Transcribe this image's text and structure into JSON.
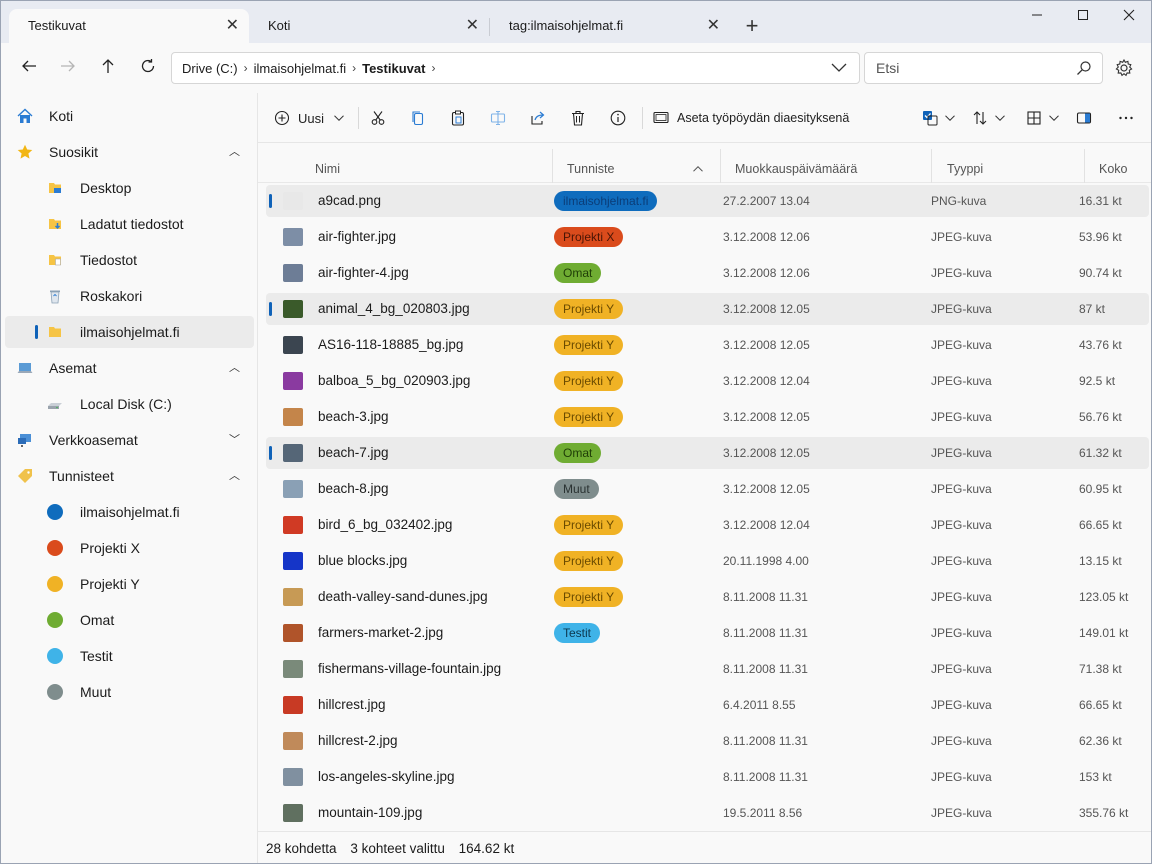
{
  "tabs": [
    {
      "label": "Testikuvat",
      "active": true
    },
    {
      "label": "Koti",
      "active": false
    },
    {
      "label": "tag:ilmaisohjelmat.fi",
      "active": false
    }
  ],
  "address": {
    "crumbs": [
      "Drive (C:)",
      "ilmaisohjelmat.fi",
      "Testikuvat"
    ],
    "search_placeholder": "Etsi"
  },
  "sidebar": {
    "items": [
      {
        "label": "Koti",
        "icon": "home-icon"
      },
      {
        "label": "Suosikit",
        "icon": "star-icon",
        "expanded": true
      },
      {
        "label": "Desktop",
        "icon": "desktop-folder-icon"
      },
      {
        "label": "Ladatut tiedostot",
        "icon": "downloads-folder-icon"
      },
      {
        "label": "Tiedostot",
        "icon": "documents-folder-icon"
      },
      {
        "label": "Roskakori",
        "icon": "recycle-bin-icon"
      },
      {
        "label": "ilmaisohjelmat.fi",
        "icon": "folder-icon",
        "selected": true
      },
      {
        "label": "Asemat",
        "icon": "drives-icon",
        "expanded": true
      },
      {
        "label": "Local Disk (C:)",
        "icon": "local-disk-icon"
      },
      {
        "label": "Verkkoasemat",
        "icon": "network-icon",
        "expanded": false
      },
      {
        "label": "Tunnisteet",
        "icon": "tag-icon",
        "expanded": true
      },
      {
        "label": "ilmaisohjelmat.fi",
        "color": "#0f6cbd"
      },
      {
        "label": "Projekti X",
        "color": "#da4b1c"
      },
      {
        "label": "Projekti Y",
        "color": "#f0b225"
      },
      {
        "label": "Omat",
        "color": "#6fac32"
      },
      {
        "label": "Testit",
        "color": "#3fb3e8"
      },
      {
        "label": "Muut",
        "color": "#7f8d8d"
      }
    ]
  },
  "toolbar": {
    "new_label": "Uusi",
    "wallpaper_label": "Aseta työpöydän diaesityksenä"
  },
  "columns": {
    "name": "Nimi",
    "tag": "Tunniste",
    "modified": "Muokkauspäivämäärä",
    "type": "Tyyppi",
    "size": "Koko",
    "sorted_by": "Tunniste"
  },
  "files": [
    {
      "name": "a9cad.png",
      "tag": "ilmaisohjelmat.fi",
      "date": "27.2.2007 13.04",
      "type": "PNG-kuva",
      "size": "16.31 kt",
      "selected": true
    },
    {
      "name": "air-fighter.jpg",
      "tag": "Projekti X",
      "date": "3.12.2008 12.06",
      "type": "JPEG-kuva",
      "size": "53.96 kt"
    },
    {
      "name": "air-fighter-4.jpg",
      "tag": "Omat",
      "date": "3.12.2008 12.06",
      "type": "JPEG-kuva",
      "size": "90.74 kt"
    },
    {
      "name": "animal_4_bg_020803.jpg",
      "tag": "Projekti Y",
      "date": "3.12.2008 12.05",
      "type": "JPEG-kuva",
      "size": "87 kt",
      "selected": true
    },
    {
      "name": "AS16-118-18885_bg.jpg",
      "tag": "Projekti Y",
      "date": "3.12.2008 12.05",
      "type": "JPEG-kuva",
      "size": "43.76 kt"
    },
    {
      "name": "balboa_5_bg_020903.jpg",
      "tag": "Projekti Y",
      "date": "3.12.2008 12.04",
      "type": "JPEG-kuva",
      "size": "92.5 kt"
    },
    {
      "name": "beach-3.jpg",
      "tag": "Projekti Y",
      "date": "3.12.2008 12.05",
      "type": "JPEG-kuva",
      "size": "56.76 kt"
    },
    {
      "name": "beach-7.jpg",
      "tag": "Omat",
      "date": "3.12.2008 12.05",
      "type": "JPEG-kuva",
      "size": "61.32 kt",
      "selected": true
    },
    {
      "name": "beach-8.jpg",
      "tag": "Muut",
      "date": "3.12.2008 12.05",
      "type": "JPEG-kuva",
      "size": "60.95 kt"
    },
    {
      "name": "bird_6_bg_032402.jpg",
      "tag": "Projekti Y",
      "date": "3.12.2008 12.04",
      "type": "JPEG-kuva",
      "size": "66.65 kt"
    },
    {
      "name": "blue blocks.jpg",
      "tag": "Projekti Y",
      "date": "20.11.1998 4.00",
      "type": "JPEG-kuva",
      "size": "13.15 kt"
    },
    {
      "name": "death-valley-sand-dunes.jpg",
      "tag": "Projekti Y",
      "date": "8.11.2008 11.31",
      "type": "JPEG-kuva",
      "size": "123.05 kt"
    },
    {
      "name": "farmers-market-2.jpg",
      "tag": "Testit",
      "date": "8.11.2008 11.31",
      "type": "JPEG-kuva",
      "size": "149.01 kt"
    },
    {
      "name": "fishermans-village-fountain.jpg",
      "tag": "",
      "date": "8.11.2008 11.31",
      "type": "JPEG-kuva",
      "size": "71.38 kt"
    },
    {
      "name": "hillcrest.jpg",
      "tag": "",
      "date": "6.4.2011 8.55",
      "type": "JPEG-kuva",
      "size": "66.65 kt"
    },
    {
      "name": "hillcrest-2.jpg",
      "tag": "",
      "date": "8.11.2008 11.31",
      "type": "JPEG-kuva",
      "size": "62.36 kt"
    },
    {
      "name": "los-angeles-skyline.jpg",
      "tag": "",
      "date": "8.11.2008 11.31",
      "type": "JPEG-kuva",
      "size": "153 kt"
    },
    {
      "name": "mountain-109.jpg",
      "tag": "",
      "date": "19.5.2011 8.56",
      "type": "JPEG-kuva",
      "size": "355.76 kt"
    }
  ],
  "tag_colors": {
    "ilmaisohjelmat.fi": "#0f6cbd",
    "Projekti X": "#da4b1c",
    "Projekti Y": "#f0b225",
    "Omat": "#6fac32",
    "Testit": "#3fb3e8",
    "Muut": "#7f8d8d"
  },
  "thumb_colors": [
    "#e8e8e8",
    "#7d8ea6",
    "#6d7d96",
    "#3a5a2a",
    "#3b4550",
    "#8a3aa0",
    "#c4854a",
    "#556677",
    "#8aa0b5",
    "#d03a24",
    "#1535c8",
    "#c79a55",
    "#b0542a",
    "#7a8a7a",
    "#c83a24",
    "#c08a5a",
    "#8090a0",
    "#607060"
  ],
  "status": {
    "count": "28 kohdetta",
    "selected": "3 kohteet valittu",
    "size": "164.62 kt"
  }
}
